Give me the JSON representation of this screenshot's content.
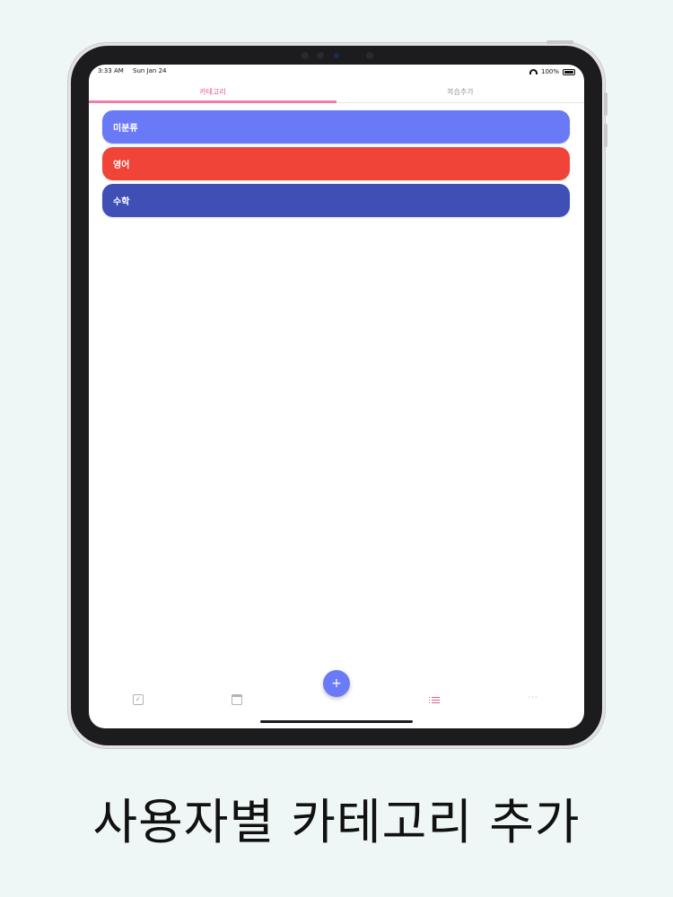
{
  "status": {
    "time": "3:33 AM",
    "date": "Sun Jan 24",
    "battery": "100%"
  },
  "tabs": [
    {
      "label": "카테고리",
      "active": true
    },
    {
      "label": "복습추가",
      "active": false
    }
  ],
  "categories": [
    {
      "label": "미분류",
      "color": "#6a7af7"
    },
    {
      "label": "영어",
      "color": "#ef4437"
    },
    {
      "label": "수학",
      "color": "#3f4fb6"
    }
  ],
  "bottom_nav": [
    {
      "icon": "checkbox-icon"
    },
    {
      "icon": "calendar-icon"
    },
    {
      "icon": "add-icon",
      "label": "+"
    },
    {
      "icon": "list-icon"
    },
    {
      "icon": "more-icon",
      "label": "···"
    }
  ],
  "caption": "사용자별 카테고리 추가",
  "colors": {
    "accent": "#e2578f",
    "fab": "#6b7bf7",
    "background": "#eef7f5"
  }
}
